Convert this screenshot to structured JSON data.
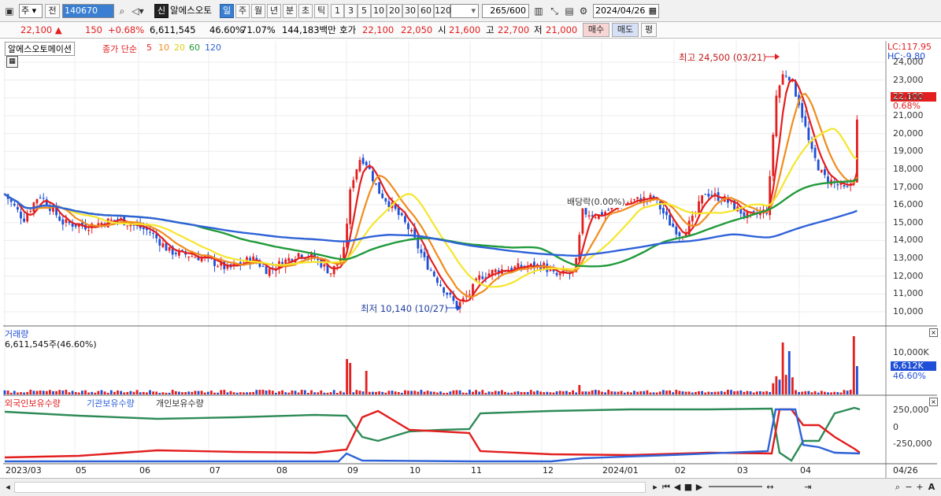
{
  "toolbar": {
    "period_type": "주",
    "prev_label": "전",
    "code": "140670",
    "new_badge": "신",
    "stock_name": "알에스오토",
    "periods": [
      "일",
      "주",
      "월",
      "년",
      "분",
      "초",
      "틱"
    ],
    "minutes": [
      "1",
      "3",
      "5",
      "10",
      "20",
      "30",
      "60",
      "120"
    ],
    "count": "265",
    "count_max": "/600",
    "date": "2024/04/26"
  },
  "info": {
    "price": "22,100",
    "change_arrow": "▲",
    "change": "150",
    "change_pct": "+0.68%",
    "volume": "6,611,545",
    "vol_pct": "46.60%",
    "rate2": "71.07%",
    "amount": "144,183백만",
    "hoga_label": "호가",
    "ask": "22,100",
    "bid": "22,050",
    "open_label": "시",
    "open": "21,600",
    "high_label": "고",
    "high": "22,700",
    "low_label": "저",
    "low": "21,000",
    "buy_label": "매수",
    "sell_label": "매도",
    "eval_label": "평"
  },
  "price_panel": {
    "title": "알에스오토메이션",
    "ma_label": "종가 단순",
    "ma_periods": [
      "5",
      "10",
      "20",
      "60",
      "120"
    ],
    "lc": "LC:117.95",
    "hc": "HC:-9.80",
    "current_price": "22,100",
    "current_pct": "0.68%",
    "high_annotation": "최고 24,500 (03/21)",
    "low_annotation": "최저 10,140 (10/27)",
    "dividend_annotation": "배당락(0.00%)",
    "y_ticks": [
      "24,000",
      "23,000",
      "22,000",
      "21,000",
      "20,000",
      "19,000",
      "18,000",
      "17,000",
      "16,000",
      "15,000",
      "14,000",
      "13,000",
      "12,000",
      "11,000",
      "10,000"
    ]
  },
  "volume_panel": {
    "title": "거래량",
    "value": "6,611,545주(46.60%)",
    "tick": "10,000K",
    "current": "6,612K",
    "current_pct": "46.60%"
  },
  "holder_panel": {
    "foreign_label": "외국인보유수량",
    "inst_label": "기관보유수량",
    "indiv_label": "개인보유수량",
    "y_ticks": [
      "250,000",
      "0",
      "-250,000"
    ]
  },
  "x_axis": [
    "2023/03",
    "05",
    "06",
    "07",
    "08",
    "09",
    "10",
    "11",
    "12",
    "2024/01",
    "02",
    "03",
    "04"
  ],
  "x_end": "04/26",
  "colors": {
    "up": "#e31e1e",
    "down": "#1f4fd6",
    "ma5": "#e31e1e",
    "ma10": "#f08c1e",
    "ma20": "#f5e62a",
    "ma60": "#1f9a3a",
    "ma120": "#2f62d8",
    "inst": "#2e8b57",
    "indiv": "#2f62d8"
  }
}
